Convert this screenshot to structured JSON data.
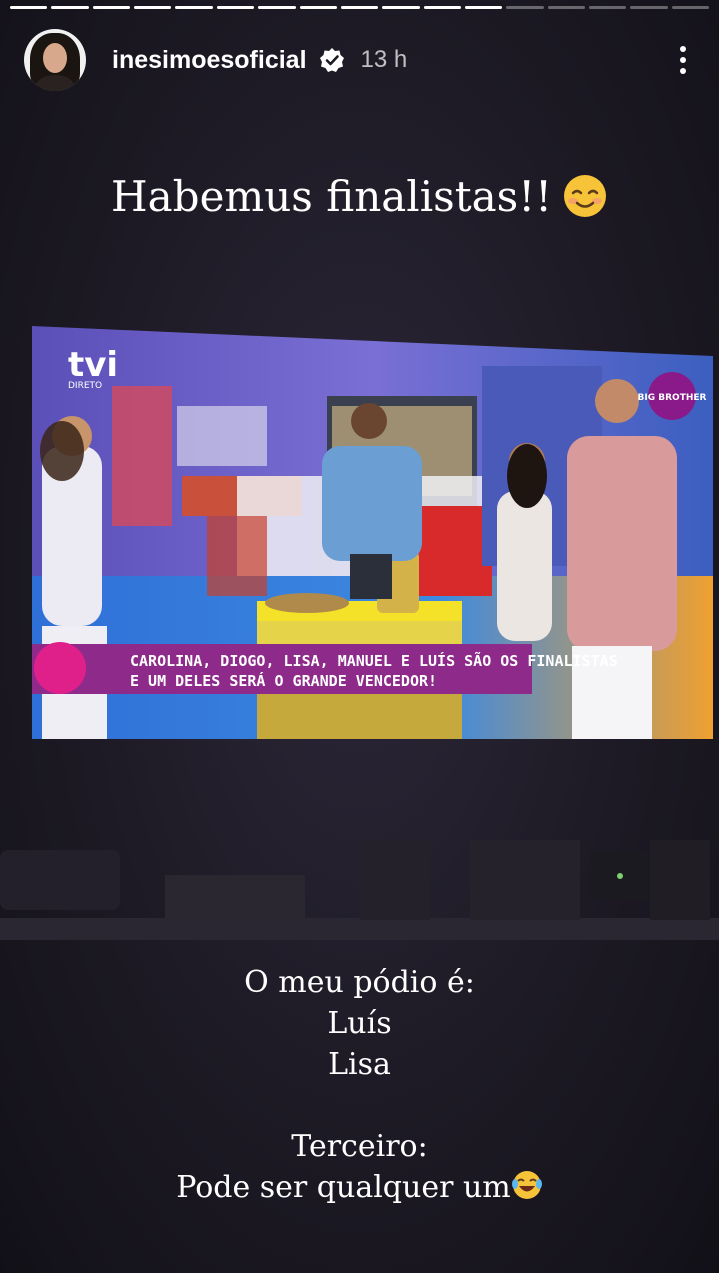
{
  "progress": {
    "segments_total": 17,
    "segments_seen": 12
  },
  "user": {
    "username": "inesimoesoficial",
    "time": "13 h",
    "verified": true
  },
  "captions": {
    "top": "Habemus finalistas!!",
    "top_emoji": "smiling-face-icon",
    "bottom_lines": [
      "O meu pódio é:",
      "Luís",
      "Lisa",
      "",
      "Terceiro:",
      "Pode ser qualquer um"
    ],
    "bottom_emoji": "laughing-tears-icon"
  },
  "tv_screen": {
    "channel_logo": "tvi",
    "live_label": "DIRETO",
    "show_logo": "BIG BROTHER",
    "ticker_line1": "CAROLINA, DIOGO, LISA, MANUEL E LUÍS SÃO OS FINALISTAS",
    "ticker_line2": "E UM DELES SERÁ O GRANDE VENCEDOR!"
  },
  "colors": {
    "ticker_bg": "#8e2a8a",
    "ticker_accent": "#e0208a",
    "background": "#1d1a25"
  }
}
